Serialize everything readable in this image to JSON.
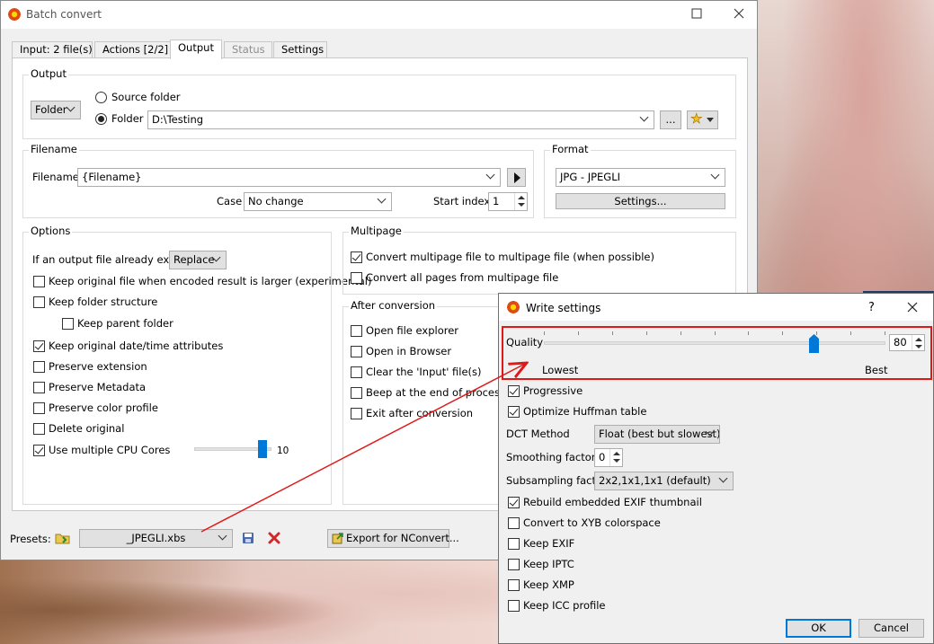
{
  "window": {
    "title": "Batch convert",
    "tabs": [
      {
        "label": "Input: 2 file(s)"
      },
      {
        "label": "Actions [2/2]"
      },
      {
        "label": "Output"
      },
      {
        "label": "Status"
      },
      {
        "label": "Settings"
      }
    ]
  },
  "output": {
    "group_title": "Output",
    "dest_type": "Folder",
    "radio_source": "Source folder",
    "radio_folder": "Folder",
    "folder_path": "D:\\Testing",
    "browse_label": "...",
    "star_glyph": "★"
  },
  "filename": {
    "group_title": "Filename",
    "label": "Filename",
    "value": "{Filename}",
    "case_label": "Case",
    "case_value": "No change",
    "start_index_label": "Start index",
    "start_index_value": "1"
  },
  "format": {
    "group_title": "Format",
    "value": "JPG - JPEGLI",
    "settings_label": "Settings..."
  },
  "options": {
    "group_title": "Options",
    "if_exists_label": "If an output file already exists",
    "if_exists_value": "Replace",
    "items": [
      {
        "label": "Keep original file when encoded result is larger (experimental)",
        "checked": false
      },
      {
        "label": "Keep folder structure",
        "checked": false
      },
      {
        "label": "Keep parent folder",
        "checked": false
      },
      {
        "label": "Keep original date/time attributes",
        "checked": true
      },
      {
        "label": "Preserve extension",
        "checked": false
      },
      {
        "label": "Preserve Metadata",
        "checked": false
      },
      {
        "label": "Preserve color profile",
        "checked": false
      },
      {
        "label": "Delete original",
        "checked": false
      },
      {
        "label": "Use multiple CPU Cores",
        "checked": true
      }
    ],
    "cpu_cores_value": "10",
    "cpu_cores_fraction": 0.93
  },
  "multipage": {
    "group_title": "Multipage",
    "items": [
      {
        "label": "Convert multipage file to multipage file (when possible)",
        "checked": true
      },
      {
        "label": "Convert all pages from multipage file",
        "checked": false
      }
    ]
  },
  "after": {
    "group_title": "After conversion",
    "items": [
      {
        "label": "Open file explorer",
        "checked": false
      },
      {
        "label": "Open in Browser",
        "checked": false
      },
      {
        "label": "Clear the 'Input' file(s)",
        "checked": false
      },
      {
        "label": "Beep at the end of process",
        "checked": false
      },
      {
        "label": "Exit after conversion",
        "checked": false
      }
    ]
  },
  "presets": {
    "label": "Presets:",
    "value": "_JPEGLI.xbs",
    "export_label": "Export for NConvert..."
  },
  "dialog": {
    "title": "Write settings",
    "help": "?",
    "quality_label": "Quality",
    "quality_value": "80",
    "quality_fraction": 0.8,
    "lowest_label": "Lowest",
    "best_label": "Best",
    "progressive_label": "Progressive",
    "progressive_checked": true,
    "huffman_label": "Optimize Huffman table",
    "huffman_checked": true,
    "dct_label": "DCT Method",
    "dct_value": "Float (best but slowest)",
    "smoothing_label": "Smoothing factor",
    "smoothing_value": "0",
    "subsampling_label": "Subsampling factor",
    "subsampling_value": "2x2,1x1,1x1 (default)",
    "checks": [
      {
        "label": "Rebuild embedded EXIF thumbnail",
        "checked": true
      },
      {
        "label": "Convert to XYB colorspace",
        "checked": false
      },
      {
        "label": "Keep EXIF",
        "checked": false
      },
      {
        "label": "Keep IPTC",
        "checked": false
      },
      {
        "label": "Keep XMP",
        "checked": false
      },
      {
        "label": "Keep ICC profile",
        "checked": false
      }
    ],
    "ok_label": "OK",
    "cancel_label": "Cancel"
  },
  "colors": {
    "accent": "#0078d7",
    "highlight": "#e01818"
  }
}
